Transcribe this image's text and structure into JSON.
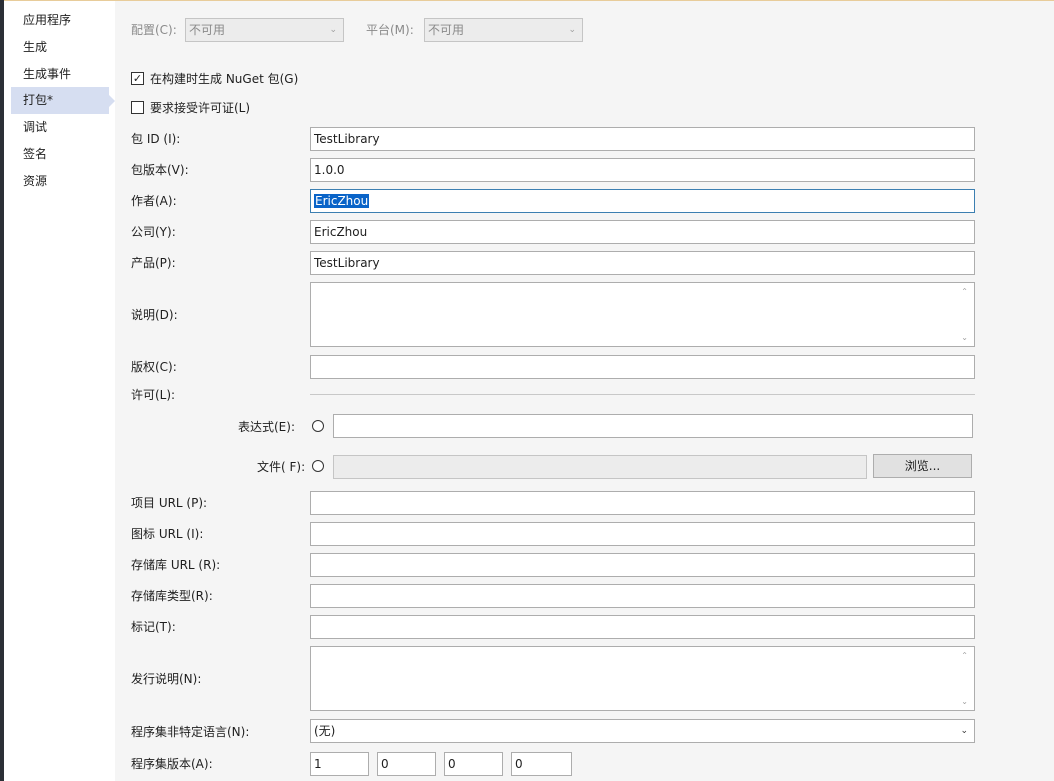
{
  "nav": {
    "items": [
      {
        "label": "应用程序"
      },
      {
        "label": "生成"
      },
      {
        "label": "生成事件"
      },
      {
        "label": "打包*"
      },
      {
        "label": "调试"
      },
      {
        "label": "签名"
      },
      {
        "label": "资源"
      }
    ]
  },
  "top": {
    "config_label": "配置(C):",
    "config_value": "不可用",
    "platform_label": "平台(M):",
    "platform_value": "不可用"
  },
  "options": {
    "generate_nuget_label": "在构建时生成 NuGet 包(G)",
    "generate_nuget_checked": true,
    "require_license_label": "要求接受许可证(L)",
    "require_license_checked": false
  },
  "fields": {
    "package_id": {
      "label": "包 ID (I):",
      "value": "TestLibrary"
    },
    "package_version": {
      "label": "包版本(V):",
      "value": "1.0.0"
    },
    "authors": {
      "label": "作者(A):",
      "value": "EricZhou"
    },
    "company": {
      "label": "公司(Y):",
      "value": "EricZhou"
    },
    "product": {
      "label": "产品(P):",
      "value": "TestLibrary"
    },
    "description": {
      "label": "说明(D):",
      "value": ""
    },
    "copyright": {
      "label": "版权(C):",
      "value": ""
    },
    "license": {
      "label": "许可(L):"
    },
    "license_expression": {
      "label": "表达式(E):",
      "value": ""
    },
    "license_file": {
      "label": "文件( F):",
      "value": "",
      "browse": "浏览..."
    },
    "project_url": {
      "label": "项目 URL (P):",
      "value": ""
    },
    "icon_url": {
      "label": "图标 URL (I):",
      "value": ""
    },
    "repo_url": {
      "label": "存储库 URL (R):",
      "value": ""
    },
    "repo_type": {
      "label": "存储库类型(R):",
      "value": ""
    },
    "tags": {
      "label": "标记(T):",
      "value": ""
    },
    "release_notes": {
      "label": "发行说明(N):",
      "value": ""
    },
    "neutral_language": {
      "label": "程序集非特定语言(N):",
      "value": "(无)"
    },
    "assembly_version": {
      "label": "程序集版本(A):",
      "parts": [
        "1",
        "0",
        "0",
        "0"
      ]
    }
  },
  "icons": {
    "dropdown": "chevron-down-icon",
    "check": "checkmark-icon",
    "scroll_up": "scroll-up-arrow-icon",
    "scroll_down": "scroll-down-arrow-icon"
  }
}
